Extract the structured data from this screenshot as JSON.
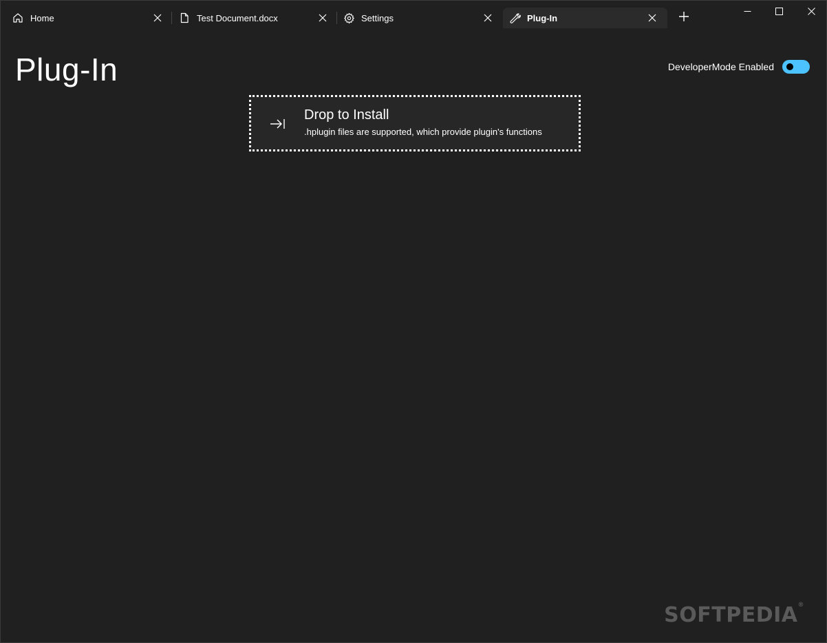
{
  "tabs": [
    {
      "label": "Home",
      "icon": "home-icon"
    },
    {
      "label": "Test Document.docx",
      "icon": "document-icon"
    },
    {
      "label": "Settings",
      "icon": "gear-icon"
    },
    {
      "label": "Plug-In",
      "icon": "wrench-icon",
      "active": true
    }
  ],
  "page": {
    "title": "Plug-In",
    "developer_mode_label": "DeveloperMode Enabled",
    "developer_mode_on": true
  },
  "dropzone": {
    "title": "Drop to Install",
    "subtitle": ".hplugin files are supported, which provide plugin's functions"
  },
  "watermark": {
    "text": "SOFTPEDIA",
    "mark": "®"
  },
  "colors": {
    "background": "#202020",
    "active_tab": "#2b2b2b",
    "accent": "#4cc2ff"
  }
}
